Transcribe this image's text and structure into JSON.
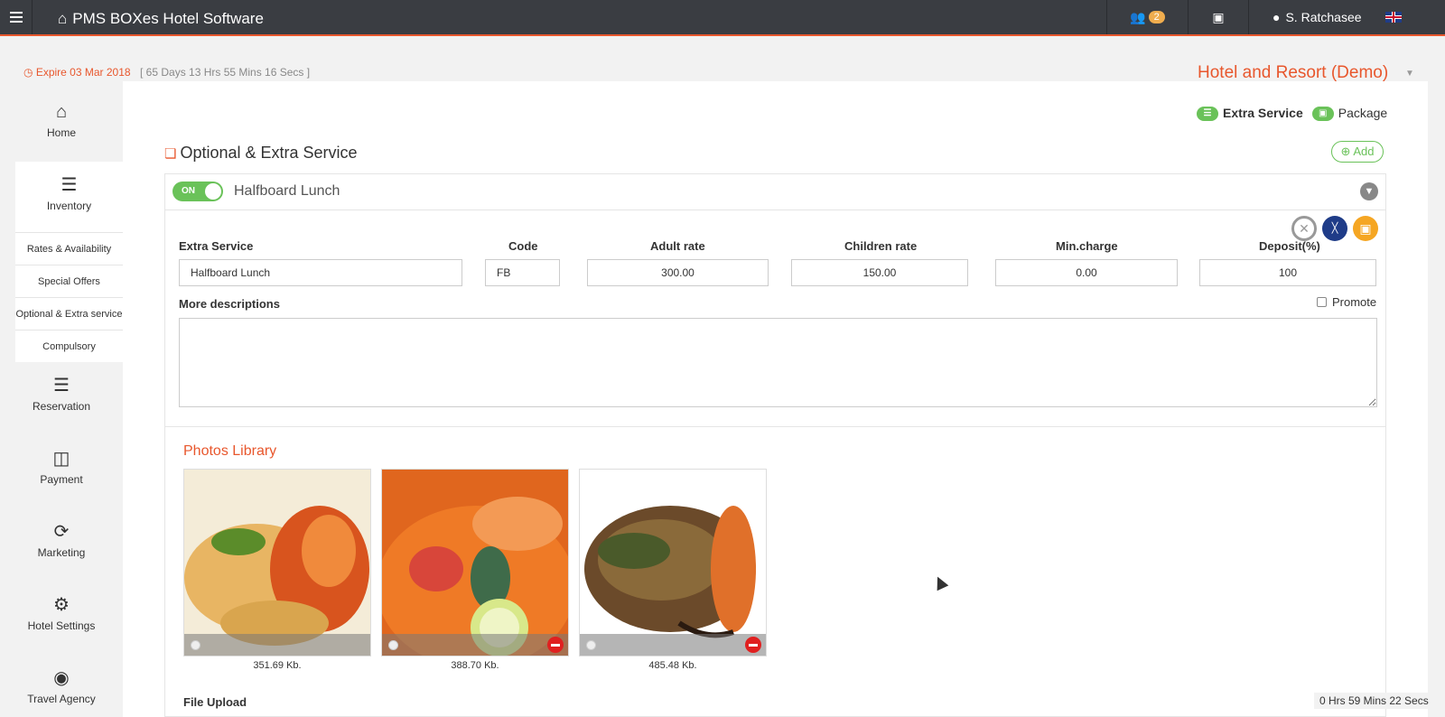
{
  "app": {
    "title": "PMS BOXes Hotel Software",
    "notification_count": "2",
    "user_name": "S. Ratchasee"
  },
  "status": {
    "expire": "Expire 03 Mar 2018",
    "countdown": "[ 65 Days 13 Hrs 55 Mins 16 Secs ]",
    "hotel_name": "Hotel and Resort (Demo)",
    "session_timer": "0 Hrs 59 Mins 22 Secs"
  },
  "sidebar": {
    "home": "Home",
    "inventory": "Inventory",
    "sub_items": [
      "Rates & Availability",
      "Special Offers",
      "Optional & Extra service",
      "Compulsory"
    ],
    "reservation": "Reservation",
    "payment": "Payment",
    "marketing": "Marketing",
    "hotel_settings": "Hotel Settings",
    "travel_agency": "Travel Agency"
  },
  "tabs": {
    "extra_service": "Extra Service",
    "package": "Package"
  },
  "section": {
    "title": "Optional & Extra Service",
    "add_label": "Add"
  },
  "item": {
    "toggle": "ON",
    "name": "Halfboard Lunch",
    "labels": {
      "extra_service": "Extra Service",
      "code": "Code",
      "adult_rate": "Adult rate",
      "children_rate": "Children rate",
      "min_charge": "Min.charge",
      "deposit": "Deposit(%)"
    },
    "values": {
      "extra_service": "Halfboard Lunch",
      "code": "FB",
      "adult_rate": "300.00",
      "children_rate": "150.00",
      "min_charge": "0.00",
      "deposit": "100"
    },
    "more_descriptions": "More descriptions",
    "promote": "Promote"
  },
  "photos": {
    "title": "Photos Library",
    "sizes": [
      "351.69 Kb.",
      "388.70 Kb.",
      "485.48 Kb."
    ]
  },
  "file_upload": "File Upload",
  "colors": {
    "accent": "#e8572d",
    "green": "#6ac259",
    "topbar": "#3a3d42"
  }
}
